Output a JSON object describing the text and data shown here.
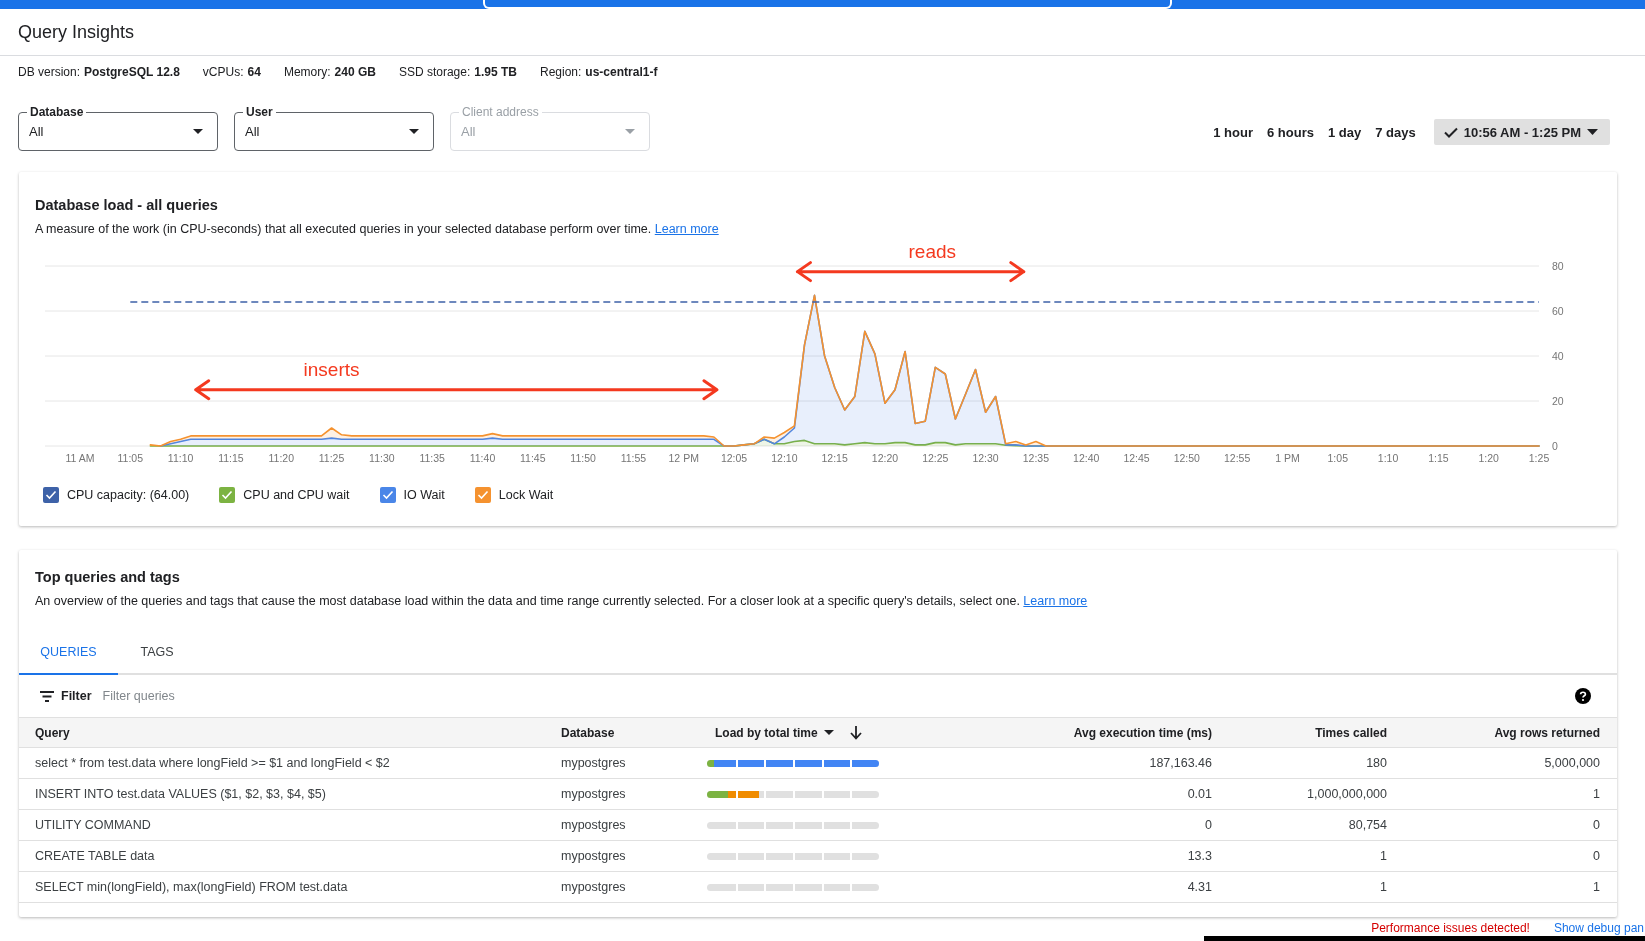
{
  "page_title": "Query Insights",
  "instance_info": [
    {
      "label": "DB version:",
      "value": "PostgreSQL 12.8"
    },
    {
      "label": "vCPUs:",
      "value": "64"
    },
    {
      "label": "Memory:",
      "value": "240 GB"
    },
    {
      "label": "SSD storage:",
      "value": "1.95 TB"
    },
    {
      "label": "Region:",
      "value": "us-central1-f"
    }
  ],
  "filters": [
    {
      "label": "Database",
      "value": "All",
      "disabled": false
    },
    {
      "label": "User",
      "value": "All",
      "disabled": false
    },
    {
      "label": "Client address",
      "value": "All",
      "disabled": true
    }
  ],
  "time_ranges": [
    {
      "label": "1 hour",
      "selected": false
    },
    {
      "label": "6 hours",
      "selected": false
    },
    {
      "label": "1 day",
      "selected": false
    },
    {
      "label": "7 days",
      "selected": false
    },
    {
      "label": "10:56 AM - 1:25 PM",
      "selected": true
    }
  ],
  "load_card": {
    "title": "Database load - all queries",
    "description": "A measure of the work (in CPU-seconds) that all executed queries in your selected database perform over time.",
    "link": "Learn more",
    "chart_data": {
      "type": "area",
      "stacked": true,
      "ylim": [
        0,
        80
      ],
      "categories": [
        "11 AM",
        null,
        null,
        null,
        null,
        "11:05",
        null,
        null,
        null,
        null,
        "11:10",
        null,
        null,
        null,
        null,
        "11:15",
        null,
        null,
        null,
        null,
        "11:20",
        null,
        null,
        null,
        null,
        "11:25",
        null,
        null,
        null,
        null,
        "11:30",
        null,
        null,
        null,
        null,
        "11:35",
        null,
        null,
        null,
        null,
        "11:40",
        null,
        null,
        null,
        null,
        "11:45",
        null,
        null,
        null,
        null,
        "11:50",
        null,
        null,
        null,
        null,
        "11:55",
        null,
        null,
        null,
        null,
        "12 PM",
        null,
        null,
        null,
        null,
        "12:05",
        null,
        null,
        null,
        null,
        "12:10",
        null,
        null,
        null,
        null,
        "12:15",
        null,
        null,
        null,
        null,
        "12:20",
        null,
        null,
        null,
        null,
        "12:25",
        null,
        null,
        null,
        null,
        "12:30",
        null,
        null,
        null,
        null,
        "12:35",
        null,
        null,
        null,
        null,
        "12:40",
        null,
        null,
        null,
        null,
        "12:45",
        null,
        null,
        null,
        null,
        "12:50",
        null,
        null,
        null,
        null,
        "12:55",
        null,
        null,
        null,
        null,
        "1 PM",
        null,
        null,
        null,
        null,
        "1:05",
        null,
        null,
        null,
        null,
        "1:10",
        null,
        null,
        null,
        null,
        "1:15",
        null,
        null,
        null,
        null,
        "1:20",
        null,
        null,
        null,
        null,
        "1:25"
      ],
      "series": [
        {
          "name": "CPU and CPU wait",
          "color": "#7cb342",
          "values": [
            null,
            null,
            null,
            null,
            null,
            null,
            null,
            0,
            0,
            0,
            0,
            0,
            0,
            0,
            0,
            0,
            0,
            0,
            0,
            0,
            0,
            0,
            0,
            0,
            0,
            0,
            0,
            0,
            0,
            0,
            0,
            0,
            0,
            0,
            0,
            0,
            0,
            0,
            0,
            0,
            0,
            0,
            0,
            0,
            0,
            0,
            0,
            0,
            0,
            0,
            0,
            0,
            0,
            0,
            0,
            0,
            0,
            0,
            0,
            0,
            0,
            0,
            0,
            0,
            0,
            0,
            0.5,
            1,
            3,
            1,
            1,
            2,
            2.5,
            1,
            1,
            1,
            0.5,
            1,
            1.5,
            1,
            1,
            1.5,
            1.5,
            0.5,
            0.5,
            1.5,
            1.5,
            0.5,
            1,
            1,
            1,
            1,
            0.3,
            0.2,
            0,
            0,
            0,
            0,
            0,
            0,
            0,
            0,
            0,
            0,
            0,
            0,
            0,
            0,
            0,
            0,
            0,
            0,
            0,
            0,
            0,
            0,
            0,
            0,
            0,
            0,
            0,
            0,
            0,
            0,
            0,
            0,
            0,
            0,
            0,
            0,
            0,
            0,
            0,
            0,
            0,
            0,
            0,
            0,
            0,
            0,
            0,
            0,
            0,
            0,
            0,
            0
          ]
        },
        {
          "name": "IO Wait",
          "color": "#4a86e8",
          "values": [
            null,
            null,
            null,
            null,
            null,
            null,
            null,
            null,
            0,
            1,
            2,
            3,
            3,
            3,
            3,
            3,
            3,
            3,
            3,
            3,
            3,
            3,
            3,
            3,
            3,
            3.5,
            3,
            3,
            3,
            3,
            3,
            3,
            3,
            3,
            3,
            3,
            3,
            3,
            3,
            3,
            3,
            3.5,
            3,
            3,
            3,
            3,
            3,
            3,
            3,
            3,
            3,
            3,
            3,
            3,
            3,
            3,
            3,
            3,
            3,
            3,
            3,
            3,
            3,
            3,
            0,
            0,
            0,
            0,
            0,
            0,
            3,
            6,
            42.5,
            66,
            39,
            25,
            15.5,
            21,
            49.5,
            40,
            18,
            23.5,
            40.5,
            9.5,
            10.5,
            33.5,
            30.5,
            11.5,
            22,
            33,
            14,
            21,
            0.2,
            0.3,
            0,
            0,
            0,
            0,
            0,
            0,
            0,
            0,
            0,
            0,
            0,
            0,
            0,
            0,
            0,
            0,
            0,
            0,
            0,
            0,
            0,
            0,
            0,
            0,
            0,
            0,
            0,
            0,
            0,
            0,
            0,
            0,
            0,
            0,
            0,
            0,
            0,
            0,
            0,
            0,
            0,
            0,
            0,
            0,
            0,
            0,
            0,
            0,
            0,
            0,
            0,
            0
          ]
        },
        {
          "name": "Lock Wait",
          "color": "#f5922f",
          "values": [
            null,
            null,
            null,
            null,
            null,
            null,
            null,
            0.5,
            0,
            1,
            1,
            1.5,
            1.5,
            1.5,
            1.5,
            1.5,
            1.5,
            1.5,
            1.5,
            1.5,
            1.5,
            1.5,
            1.5,
            1.5,
            1.5,
            4.5,
            2,
            1.5,
            1.5,
            1.5,
            1.5,
            1.5,
            1.5,
            1.5,
            1.5,
            1.5,
            1.5,
            1.5,
            1.5,
            1.5,
            1.5,
            2,
            1.5,
            1.5,
            1.5,
            1.5,
            1.5,
            1.5,
            1.5,
            1.5,
            1.5,
            1.5,
            1.5,
            1.5,
            1.5,
            1.5,
            1.5,
            1.5,
            1.5,
            1.5,
            1.5,
            1.5,
            1.5,
            1,
            0,
            0,
            0,
            0,
            1,
            2.5,
            2,
            1,
            0,
            0,
            0,
            0,
            0,
            0,
            0,
            0,
            0,
            0,
            0,
            0,
            0,
            0,
            0,
            0,
            0,
            0,
            0,
            0,
            0.5,
            1.5,
            0.5,
            2,
            0,
            0,
            0,
            0,
            0,
            0,
            0,
            0,
            0,
            0,
            0,
            0,
            0,
            0,
            0,
            0,
            0,
            0,
            0,
            0,
            0,
            0,
            0,
            0,
            0,
            0,
            0,
            0,
            0,
            0,
            0,
            0,
            0,
            0,
            0,
            0,
            0,
            0,
            0,
            0,
            0,
            0,
            0,
            0,
            0,
            0,
            0,
            0,
            0,
            0
          ]
        }
      ],
      "grid": true,
      "ref_lines": [
        {
          "axis": "y",
          "value": 64,
          "label": "CPU capacity: (64.00)",
          "color": "#3e62a8"
        }
      ],
      "yticks": [
        0,
        20,
        40,
        60,
        80
      ],
      "annotations": [
        "inserts",
        "reads"
      ]
    },
    "legend": [
      {
        "checked": true
      },
      {
        "checked": true
      },
      {
        "checked": true
      },
      {
        "checked": true
      }
    ]
  },
  "queries_card": {
    "title": "Top queries and tags",
    "description": "An overview of the queries and tags that cause the most database load within the data and time range currently selected. For a closer look at a specific query's details, select one.",
    "link": "Learn more",
    "tabs": [
      {
        "label": "QUERIES",
        "selected": true
      },
      {
        "label": "TAGS",
        "selected": false
      }
    ],
    "filter": {
      "label": "Filter",
      "placeholder": "Filter queries"
    },
    "columns": [
      {
        "label": "Query",
        "sorted": false
      },
      {
        "label": "Database",
        "sorted": false
      },
      {
        "label": "Load by total time",
        "sorted": true
      },
      {
        "label": "Avg execution time (ms)",
        "sorted": false
      },
      {
        "label": "Times called",
        "sorted": false
      },
      {
        "label": "Avg rows returned",
        "sorted": false
      }
    ],
    "rows": [
      {
        "query": "select * from test.data where longField >= $1 and longField < $2",
        "database": "mypostgres",
        "load": [
          {
            "color": "#7cb342",
            "level": 0.04
          },
          {
            "color": "#4285f4",
            "level": 0.96
          }
        ],
        "avg_execution_time": "187,163.46",
        "times_called": "180",
        "avg_rows_returned": "5,000,000"
      },
      {
        "query": "INSERT INTO test.data VALUES ($1, $2, $3, $4, $5)",
        "database": "mypostgres",
        "load": [
          {
            "color": "#7cb342",
            "level": 0.12
          },
          {
            "color": "#f08c00",
            "level": 0.18
          }
        ],
        "avg_execution_time": "0.01",
        "times_called": "1,000,000,000",
        "avg_rows_returned": "1"
      },
      {
        "query": "UTILITY COMMAND",
        "database": "mypostgres",
        "avg_execution_time": "0",
        "times_called": "80,754",
        "avg_rows_returned": "0"
      },
      {
        "query": "CREATE TABLE data",
        "database": "mypostgres",
        "avg_execution_time": "13.3",
        "times_called": "1",
        "avg_rows_returned": "0"
      },
      {
        "query": "SELECT min(longField), max(longField) FROM test.data",
        "database": "mypostgres",
        "avg_execution_time": "4.31",
        "times_called": "1",
        "avg_rows_returned": "1"
      }
    ]
  },
  "footer": {
    "warning": "Performance issues detected!",
    "link": "Show debug pan"
  }
}
